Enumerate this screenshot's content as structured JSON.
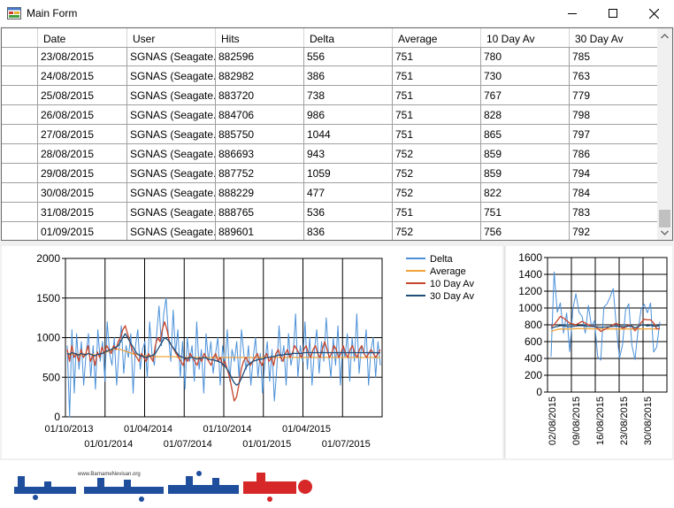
{
  "window": {
    "title": "Main Form"
  },
  "grid": {
    "columns": [
      "Date",
      "User",
      "Hits",
      "Delta",
      "Average",
      "10 Day Av",
      "30 Day Av"
    ],
    "rows": [
      [
        "23/08/2015",
        "SGNAS (Seagate...",
        "882596",
        "556",
        "751",
        "780",
        "785"
      ],
      [
        "24/08/2015",
        "SGNAS (Seagate...",
        "882982",
        "386",
        "751",
        "730",
        "763"
      ],
      [
        "25/08/2015",
        "SGNAS (Seagate...",
        "883720",
        "738",
        "751",
        "767",
        "779"
      ],
      [
        "26/08/2015",
        "SGNAS (Seagate...",
        "884706",
        "986",
        "751",
        "828",
        "798"
      ],
      [
        "27/08/2015",
        "SGNAS (Seagate...",
        "885750",
        "1044",
        "751",
        "865",
        "797"
      ],
      [
        "28/08/2015",
        "SGNAS (Seagate...",
        "886693",
        "943",
        "752",
        "859",
        "786"
      ],
      [
        "29/08/2015",
        "SGNAS (Seagate...",
        "887752",
        "1059",
        "752",
        "859",
        "794"
      ],
      [
        "30/08/2015",
        "SGNAS (Seagate...",
        "888229",
        "477",
        "752",
        "822",
        "784"
      ],
      [
        "31/08/2015",
        "SGNAS (Seagate...",
        "888765",
        "536",
        "751",
        "751",
        "783"
      ],
      [
        "01/09/2015",
        "SGNAS (Seagate...",
        "889601",
        "836",
        "752",
        "756",
        "792"
      ]
    ]
  },
  "colors": {
    "delta": "#4a90d9",
    "average": "#f0a43a",
    "day10": "#c8442a",
    "day30": "#1f4e79"
  },
  "chart_data": [
    {
      "type": "line",
      "ylim": [
        0,
        2000
      ],
      "y_ticks": [
        "2000",
        "1500",
        "1000",
        "500",
        "0"
      ],
      "x_ticks_upper": [
        "01/10/2013",
        "01/04/2014",
        "01/10/2014",
        "01/04/2015"
      ],
      "x_ticks_lower": [
        "01/01/2014",
        "01/07/2014",
        "01/01/2015",
        "01/07/2015"
      ],
      "legend": [
        "Delta",
        "Average",
        "10 Day Av",
        "30 Day Av"
      ],
      "legend_position": "right",
      "grid": true,
      "series": [
        {
          "name": "Delta",
          "values": [
            900,
            0,
            1100,
            300,
            1050,
            600,
            950,
            400,
            800,
            1050,
            500,
            900,
            350,
            1100,
            700,
            950,
            450,
            1200,
            800,
            650,
            1000,
            400,
            850,
            1150,
            550,
            900,
            750,
            1050,
            300,
            900,
            1100,
            600,
            850,
            950,
            500,
            1200,
            800,
            650,
            1050,
            1400,
            900,
            1300,
            1500,
            1000,
            700,
            1350,
            800,
            1100,
            500,
            950,
            350,
            1000,
            700,
            900,
            450,
            1200,
            600,
            850,
            300,
            1050,
            700,
            950,
            550,
            800,
            1000,
            400,
            900,
            650,
            1100,
            450,
            850,
            700,
            950,
            500,
            1100,
            800,
            600,
            900,
            400,
            750,
            1000,
            500,
            800,
            300,
            700,
            950,
            450,
            850,
            200,
            600,
            1150,
            700,
            900,
            400,
            1050,
            650,
            800,
            1300,
            500,
            900,
            700,
            1200,
            600,
            1000,
            400,
            850,
            1100,
            550,
            950,
            700,
            1250,
            800,
            500,
            1000,
            650,
            1150,
            400,
            900,
            750,
            1050,
            450,
            1000,
            700,
            1300,
            550,
            900,
            800,
            1100,
            400,
            850,
            1000,
            500,
            950,
            650
          ]
        },
        {
          "name": "Average",
          "values": [
            800,
            780,
            790,
            800,
            790,
            790,
            780,
            790,
            790,
            800,
            790,
            790,
            780,
            790,
            790,
            800,
            800,
            820,
            830,
            840,
            860,
            860,
            850,
            850,
            840,
            830,
            820,
            810,
            800,
            790,
            790,
            780,
            780,
            770,
            770,
            770,
            760,
            760,
            760,
            760,
            760,
            760,
            760,
            760,
            760,
            760,
            760,
            760,
            750,
            750,
            750,
            750,
            750,
            750,
            750,
            750,
            750,
            750,
            750,
            750,
            750,
            750,
            750,
            750,
            750,
            750,
            750,
            750,
            750,
            750,
            750,
            750,
            750,
            750,
            750,
            750,
            750,
            750,
            750,
            750,
            750,
            750,
            750,
            750,
            750,
            750,
            750,
            750,
            750,
            750,
            750,
            750,
            750,
            750,
            750,
            750,
            750,
            750,
            750,
            750,
            750,
            750,
            750,
            750,
            750,
            750,
            750,
            750,
            750,
            750,
            750,
            750,
            750,
            750,
            750,
            750,
            750,
            750,
            750,
            750,
            750,
            750,
            750,
            750,
            750,
            750,
            750,
            750,
            750,
            750,
            750,
            750,
            750,
            750,
            750,
            750
          ]
        },
        {
          "name": "10 Day Av",
          "values": [
            850,
            700,
            900,
            750,
            800,
            700,
            850,
            750,
            800,
            900,
            700,
            780,
            650,
            820,
            750,
            880,
            800,
            900,
            850,
            800,
            900,
            850,
            950,
            1000,
            1100,
            1150,
            1050,
            950,
            850,
            800,
            750,
            700,
            800,
            750,
            700,
            800,
            750,
            700,
            900,
            1000,
            950,
            1100,
            1200,
            1100,
            950,
            900,
            850,
            800,
            750,
            700,
            650,
            750,
            700,
            800,
            750,
            700,
            650,
            750,
            700,
            800,
            750,
            700,
            650,
            750,
            800,
            700,
            750,
            650,
            700,
            600,
            500,
            350,
            200,
            250,
            400,
            600,
            700,
            750,
            700,
            650,
            700,
            750,
            800,
            700,
            650,
            750,
            800,
            700,
            750,
            650,
            800,
            850,
            750,
            700,
            800,
            850,
            750,
            800,
            900,
            850,
            800,
            750,
            850,
            900,
            800,
            750,
            850,
            900,
            800,
            750,
            850,
            950,
            850,
            750,
            800,
            900,
            850,
            750,
            800,
            900,
            800,
            750,
            850,
            900,
            800,
            750,
            850,
            900,
            800,
            750,
            800,
            850,
            800,
            750,
            800,
            850
          ]
        },
        {
          "name": "30 Day Av",
          "values": [
            800,
            790,
            810,
            800,
            790,
            780,
            800,
            790,
            780,
            800,
            790,
            780,
            770,
            790,
            790,
            800,
            810,
            830,
            840,
            850,
            870,
            880,
            900,
            950,
            1000,
            1050,
            1000,
            950,
            900,
            850,
            800,
            780,
            770,
            760,
            750,
            760,
            770,
            780,
            800,
            850,
            900,
            950,
            1000,
            980,
            950,
            900,
            860,
            820,
            780,
            760,
            750,
            740,
            740,
            750,
            750,
            740,
            730,
            740,
            740,
            750,
            740,
            730,
            720,
            720,
            710,
            700,
            690,
            670,
            640,
            600,
            550,
            480,
            430,
            400,
            420,
            480,
            550,
            620,
            660,
            680,
            700,
            710,
            720,
            730,
            730,
            740,
            750,
            750,
            760,
            760,
            770,
            780,
            780,
            780,
            790,
            790,
            790,
            800,
            800,
            800,
            800,
            800,
            810,
            810,
            810,
            810,
            810,
            810,
            810,
            810,
            810,
            810,
            810,
            810,
            810,
            810,
            810,
            810,
            810,
            810,
            810,
            810,
            810,
            810,
            810,
            810,
            810,
            810,
            810,
            810,
            810,
            810,
            810,
            810,
            810,
            810
          ]
        }
      ]
    },
    {
      "type": "line",
      "ylim": [
        0,
        1600
      ],
      "y_ticks": [
        "1600",
        "1400",
        "1200",
        "1000",
        "800",
        "600",
        "400",
        "200",
        "0"
      ],
      "x_ticks": [
        "02/08/2015",
        "09/08/2015",
        "16/08/2015",
        "23/08/2015",
        "30/08/2015"
      ],
      "grid": true,
      "series": [
        {
          "name": "Delta",
          "values": [
            420,
            1430,
            950,
            1060,
            700,
            940,
            480,
            980,
            1170,
            950,
            900,
            700,
            1030,
            780,
            850,
            420,
            380,
            1010,
            1050,
            1130,
            1230,
            780,
            400,
            560,
            980,
            1050,
            556,
            386,
            738,
            986,
            1044,
            943,
            1059,
            477,
            536,
            836
          ]
        },
        {
          "name": "Average",
          "values": [
            720,
            735,
            745,
            750,
            750,
            752,
            750,
            752,
            755,
            755,
            754,
            753,
            754,
            752,
            752,
            751,
            750,
            750,
            750,
            751,
            752,
            751,
            750,
            750,
            750,
            751,
            751,
            751,
            751,
            751,
            751,
            752,
            752,
            752,
            751,
            752
          ]
        },
        {
          "name": "10 Day Av",
          "values": [
            780,
            800,
            850,
            900,
            880,
            850,
            820,
            810,
            800,
            820,
            840,
            820,
            800,
            790,
            780,
            760,
            720,
            740,
            760,
            780,
            800,
            820,
            790,
            760,
            770,
            800,
            780,
            730,
            767,
            828,
            865,
            859,
            859,
            822,
            751,
            756
          ]
        },
        {
          "name": "30 Day Av",
          "values": [
            760,
            770,
            780,
            790,
            790,
            780,
            775,
            780,
            785,
            790,
            790,
            785,
            780,
            780,
            778,
            775,
            770,
            772,
            775,
            778,
            780,
            785,
            782,
            778,
            780,
            784,
            785,
            763,
            779,
            798,
            797,
            786,
            794,
            784,
            783,
            792
          ]
        }
      ]
    }
  ],
  "footer": {
    "logo_text": "www.BarnameNevisan.org"
  }
}
